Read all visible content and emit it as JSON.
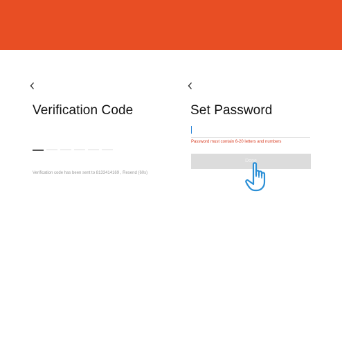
{
  "brand_color": "#E84E24",
  "accent_color": "#1F7FD6",
  "verification": {
    "back_icon": "chevron-left-icon",
    "title": "Verification Code",
    "code_slots": 6,
    "sent_message": "Verification code has been sent to 8133414169",
    "resend_label": "Resend (60s)"
  },
  "set_password": {
    "back_icon": "chevron-left-icon",
    "title": "Set Password",
    "password_value": "",
    "error_message": "Password must contain 6-20 letters and numbers",
    "button_label": "Done"
  },
  "pointer_icon": "pointing-hand-icon"
}
